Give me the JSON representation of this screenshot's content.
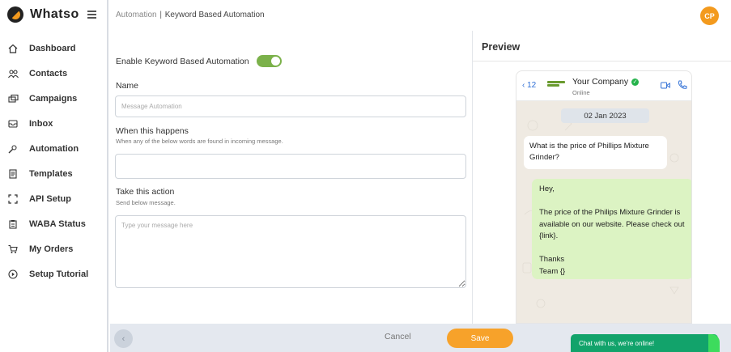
{
  "brand": {
    "name": "Whatso"
  },
  "sidebar": {
    "items": [
      {
        "label": "Dashboard",
        "icon": "home-icon"
      },
      {
        "label": "Contacts",
        "icon": "contacts-icon"
      },
      {
        "label": "Campaigns",
        "icon": "campaigns-icon"
      },
      {
        "label": "Inbox",
        "icon": "inbox-icon"
      },
      {
        "label": "Automation",
        "icon": "automation-icon"
      },
      {
        "label": "Templates",
        "icon": "templates-icon"
      },
      {
        "label": "API Setup",
        "icon": "api-icon"
      },
      {
        "label": "WABA Status",
        "icon": "waba-icon"
      },
      {
        "label": "My Orders",
        "icon": "cart-icon"
      },
      {
        "label": "Setup Tutorial",
        "icon": "play-icon"
      }
    ]
  },
  "header": {
    "breadcrumb_parent": "Automation",
    "separator": "|",
    "breadcrumb_current": "Keyword Based Automation",
    "avatar_initials": "CP"
  },
  "form": {
    "toggle_label": "Enable Keyword Based Automation",
    "toggle_on": true,
    "name_label": "Name",
    "name_placeholder": "Message Automation",
    "trigger_label": "When this happens",
    "trigger_hint": "When any of the below words are found in incoming message.",
    "trigger_value": "",
    "action_label": "Take this action",
    "action_hint": "Send below message.",
    "action_placeholder": "Type your message here"
  },
  "preview": {
    "title": "Preview",
    "back_count": "12",
    "company": "Your Company",
    "status": "Online",
    "date": "02 Jan 2023",
    "incoming_message": "What is the price of Phillips Mixture Grinder?",
    "outgoing_message": "Hey,\n\nThe price of the Philips Mixture Grinder is available on our website. Please check out {link}.\n\nThanks\nTeam {}"
  },
  "footer": {
    "cancel_label": "Cancel",
    "save_label": "Save"
  },
  "chat_widget": {
    "label": "Chat with us, we're online!"
  },
  "colors": {
    "accent_orange": "#f7a22a",
    "toggle_green": "#7bb14a",
    "bubble_green": "#dcf3c3",
    "widget_green": "#12a36b"
  }
}
